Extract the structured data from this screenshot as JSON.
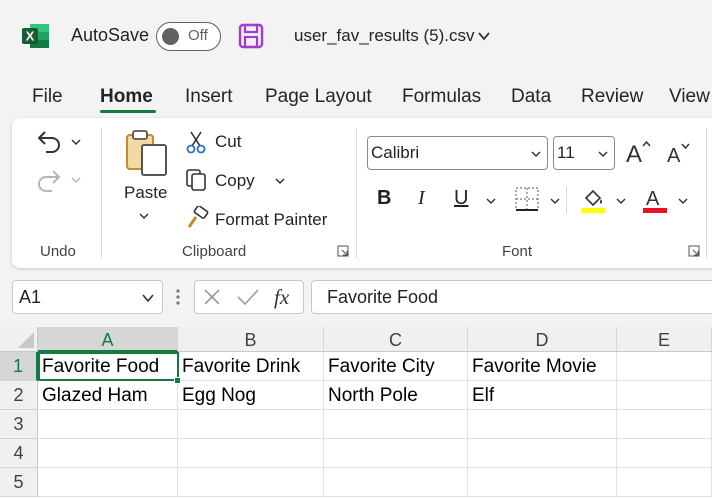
{
  "titlebar": {
    "autosave_label": "AutoSave",
    "autosave_state": "Off",
    "file_name": "user_fav_results (5).csv"
  },
  "tabs": [
    "File",
    "Home",
    "Insert",
    "Page Layout",
    "Formulas",
    "Data",
    "Review",
    "View"
  ],
  "active_tab": "Home",
  "ribbon": {
    "undo": {
      "label": "Undo"
    },
    "clipboard": {
      "label": "Clipboard",
      "paste": "Paste",
      "cut": "Cut",
      "copy": "Copy",
      "format_painter": "Format Painter"
    },
    "font": {
      "label": "Font",
      "font_name": "Calibri",
      "font_size": "11",
      "bold": "B",
      "italic": "I",
      "underline": "U",
      "highlight_color": "#ffff00",
      "font_color": "#e81123"
    }
  },
  "formula_bar": {
    "name_box": "A1",
    "formula": "Favorite Food"
  },
  "sheet": {
    "columns": [
      "A",
      "B",
      "C",
      "D",
      "E"
    ],
    "rows": [
      "1",
      "2",
      "3",
      "4",
      "5"
    ],
    "cells": [
      [
        "Favorite Food",
        "Favorite Drink",
        "Favorite City",
        "Favorite Movie",
        ""
      ],
      [
        "Glazed Ham",
        "Egg Nog",
        "North Pole",
        "Elf",
        ""
      ],
      [
        "",
        "",
        "",
        "",
        ""
      ],
      [
        "",
        "",
        "",
        "",
        ""
      ],
      [
        "",
        "",
        "",
        "",
        ""
      ]
    ],
    "active_cell": "A1"
  },
  "colors": {
    "accent": "#107c41",
    "excel_green": "#107c41",
    "save_icon": "#a33bd0"
  }
}
